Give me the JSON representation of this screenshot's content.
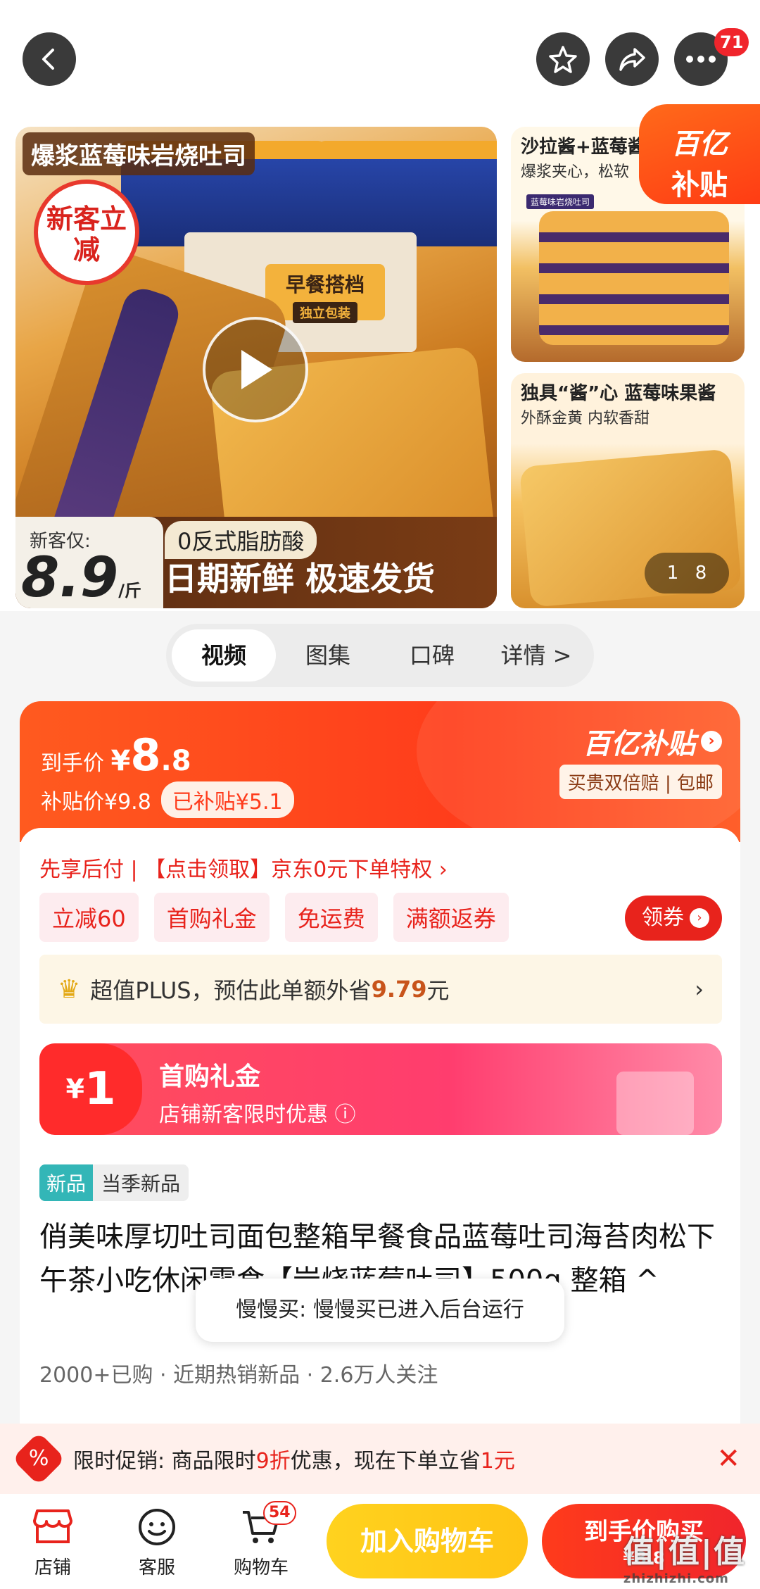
{
  "header": {
    "cart_count": "71"
  },
  "gallery": {
    "main_title": "爆浆蓝莓味岩烧吐司",
    "new_badge": "新客立减",
    "box_label_1": "早餐搭档",
    "box_label_2": "独立包装",
    "pack_text": "岩烧吐司",
    "price_label": "新客仅:",
    "price_value": "8.9",
    "price_unit": "/斤",
    "fat_tag": "0反式脂肪酸",
    "slogan": "日期新鲜 极速发货",
    "side1_title": "沙拉酱+蓝莓酱",
    "side1_sub": "爆浆夹心，松软",
    "side1_tiny": "蓝莓味岩烧吐司",
    "side2_title": "独具“酱”心 蓝莓味果酱",
    "side2_sub": "外酥金黄 内软香甜",
    "counter_current": "1",
    "counter_total": "8",
    "yi_badge_1": "百亿",
    "yi_badge_2": "补贴"
  },
  "tabs": [
    {
      "label": "视频"
    },
    {
      "label": "图集"
    },
    {
      "label": "口碑"
    },
    {
      "label": "详情 >"
    }
  ],
  "price_card": {
    "final_label": "到手价 ",
    "final_currency": "¥",
    "final_int": "8",
    "final_dec": ".8",
    "subsidy_price": "补贴价¥9.8",
    "subsidized": "已补贴¥5.1",
    "yi_logo": "百亿补贴",
    "yi_sub": "买贵双倍赔 | 包邮"
  },
  "promo": {
    "pay_later": "先享后付 | 【点击领取】京东0元下单特权 ›",
    "chips": [
      "立减60",
      "首购礼金",
      "免运费",
      "满额返券"
    ],
    "coupon_btn": "领券",
    "plus_text": "超值PLUS，预估此单额外省",
    "plus_amount": "9.79",
    "plus_unit": "元",
    "gift_currency": "¥",
    "gift_amount": "1",
    "gift_title": "首购礼金",
    "gift_sub": "店铺新客限时优惠 ⓘ"
  },
  "product": {
    "new_tag": "新品",
    "new_tag_desc": "当季新品",
    "title": "俏美味厚切吐司面包整箱早餐食品蓝莓吐司海苔肉松下午茶小吃休闲零食【岩烧蓝莓吐司】500g 整箱 ^",
    "stats": "2000+已购   · 近期热销新品   · 2.6万人关注"
  },
  "toast": "慢慢买: 慢慢买已进入后台运行",
  "promo_bar": {
    "icon": "%",
    "prefix": "限时促销: 商品限时",
    "discount": "9折",
    "middle": "优惠，现在下单立省",
    "save": "1元"
  },
  "bottom_nav": {
    "shop": "店铺",
    "service": "客服",
    "cart": "购物车",
    "cart_count": "54",
    "add_cart": "加入购物车",
    "buy": "到手价购买",
    "buy_price": "¥8.8",
    "watermark_big": "值|值|值",
    "watermark_small": "zhizhizhi.com"
  },
  "colors": {
    "brand_red": "#e8231c",
    "subsidy_orange": "#ff3d1b",
    "cart_yellow": "#ffc414"
  }
}
